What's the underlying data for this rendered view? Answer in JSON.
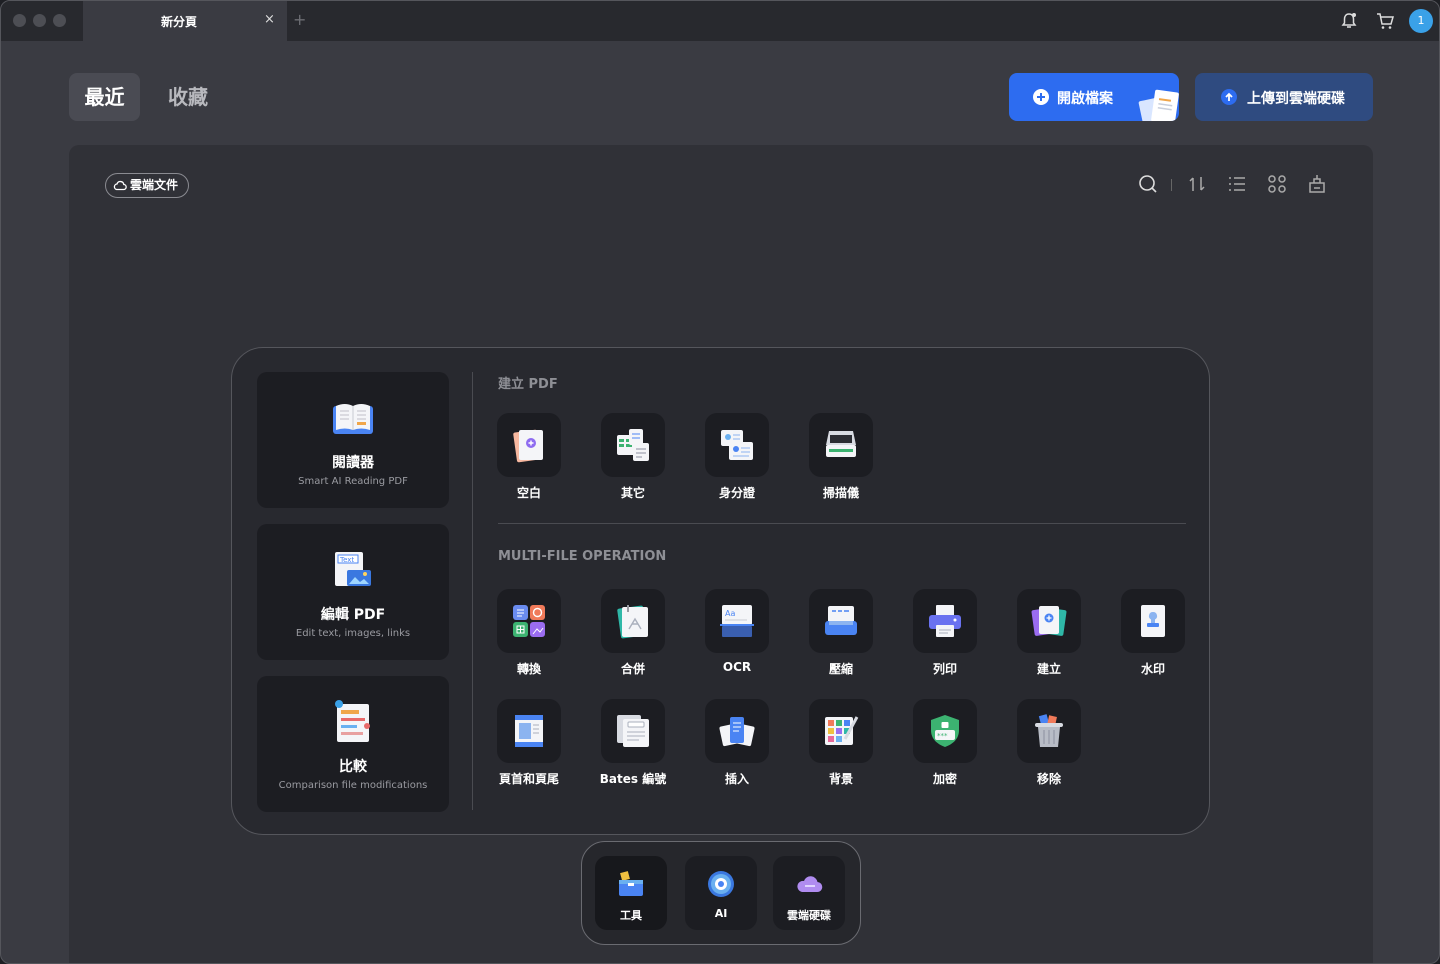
{
  "titlebar": {
    "tab_title": "新分頁",
    "tab_close": "×",
    "tab_add": "+",
    "avatar_text": "1"
  },
  "header": {
    "tabs": [
      {
        "label": "最近",
        "active": true
      },
      {
        "label": "收藏",
        "active": false
      }
    ],
    "open_file_label": "開啟檔案",
    "upload_label": "上傳到雲端硬碟"
  },
  "main": {
    "cloud_docs_label": "雲端文件",
    "toolbar_icons": [
      "search-icon",
      "sort-icon",
      "list-view-icon",
      "grid-view-icon",
      "clear-icon"
    ]
  },
  "features": [
    {
      "title": "閱讀器",
      "subtitle": "Smart AI Reading PDF"
    },
    {
      "title": "編輯 PDF",
      "subtitle": "Edit text, images, links"
    },
    {
      "title": "比較",
      "subtitle": "Comparison file modifications"
    }
  ],
  "create_section": {
    "title": "建立 PDF",
    "items": [
      {
        "label": "空白"
      },
      {
        "label": "其它"
      },
      {
        "label": "身分證"
      },
      {
        "label": "掃描儀"
      }
    ]
  },
  "multi_section": {
    "title": "MULTI-FILE OPERATION",
    "row1": [
      {
        "label": "轉換"
      },
      {
        "label": "合併"
      },
      {
        "label": "OCR"
      },
      {
        "label": "壓縮"
      },
      {
        "label": "列印"
      },
      {
        "label": "建立"
      },
      {
        "label": "水印"
      }
    ],
    "row2": [
      {
        "label": "頁首和頁尾"
      },
      {
        "label": "Bates 編號"
      },
      {
        "label": "插入"
      },
      {
        "label": "背景"
      },
      {
        "label": "加密"
      },
      {
        "label": "移除"
      }
    ]
  },
  "dock": [
    {
      "label": "工具",
      "active": true
    },
    {
      "label": "AI"
    },
    {
      "label": "雲端硬碟"
    }
  ],
  "colors": {
    "primary": "#2d6cf0",
    "upload_btn": "#2f4b80",
    "avatar": "#3aa1e8"
  }
}
